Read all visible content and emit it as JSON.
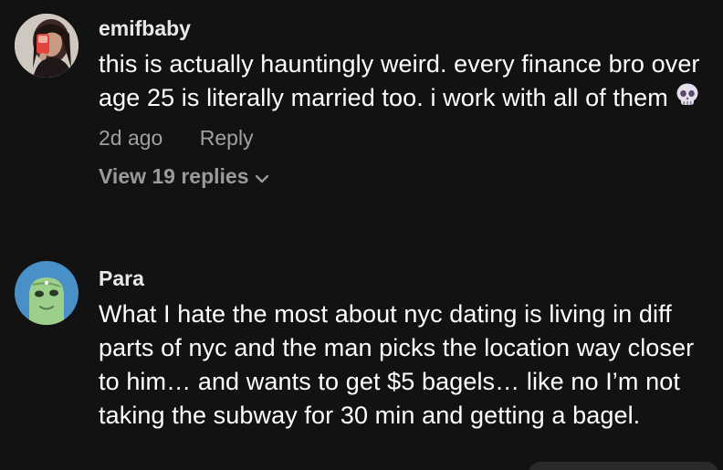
{
  "comments": [
    {
      "username": "emifbaby",
      "text": "this is actually hauntingly weird. every finance bro over age 25 is literally married too. i work with all of them",
      "emoji": "skull-icon",
      "time": "2d ago",
      "reply_label": "Reply",
      "view_replies": "View 19 replies"
    },
    {
      "username": "Para",
      "text": "What I hate the most about nyc dating is living in diff parts of nyc and the man picks the location way closer to him… and wants to get $5 bagels… like no I’m not taking the subway for 30 min and getting a bagel."
    }
  ],
  "colors": {
    "background": "#121212",
    "text": "#ffffff",
    "muted": "#a0a0a0",
    "avatar2_bg": "#4a90c8",
    "avatar2_face": "#9ccf8a"
  }
}
